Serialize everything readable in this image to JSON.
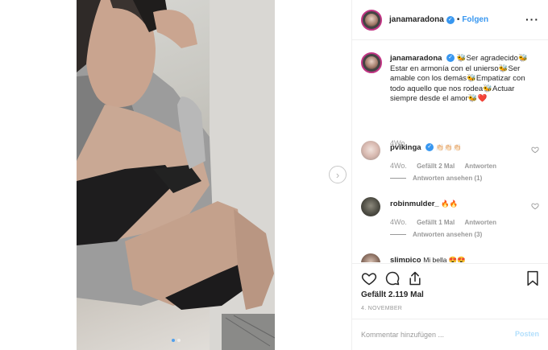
{
  "post": {
    "photo_label": "",
    "carousel": {
      "count": 2,
      "active_index": 0
    }
  },
  "header": {
    "username": "janamaradona",
    "separator": "•",
    "follow_label": "Folgen",
    "more_label": "···"
  },
  "caption": {
    "username": "janamaradona",
    "text": "🐝Ser agradecido🐝Estar en armonía con el unierso🐝Ser amable con los demás🐝Empatizar con todo aquello que nos rodea🐝Actuar siempre desde el amor🐝❤️",
    "time": "4Wo."
  },
  "comments": [
    {
      "username": "pvikinga",
      "verified": true,
      "text": "👏🏻👏🏻👏🏻",
      "time": "4Wo.",
      "likes": "Gefällt 2 Mal",
      "reply_label": "Antworten",
      "view_replies": "Antworten ansehen (1)"
    },
    {
      "username": "robinmulder_",
      "verified": false,
      "text": "🔥🔥",
      "time": "4Wo.",
      "likes": "Gefällt 1 Mal",
      "reply_label": "Antworten",
      "view_replies": "Antworten ansehen (3)"
    },
    {
      "username": "slimpico",
      "verified": false,
      "text": "Mi bella 😍😍"
    }
  ],
  "actions": {
    "likes_text": "Gefällt 2.119 Mal",
    "date": "4. NOVEMBER"
  },
  "composer": {
    "placeholder": "Kommentar hinzufügen ...",
    "post_label": "Posten"
  },
  "colors": {
    "accent": "#3897f0",
    "story_ring": "#c13584",
    "muted": "#999999"
  }
}
